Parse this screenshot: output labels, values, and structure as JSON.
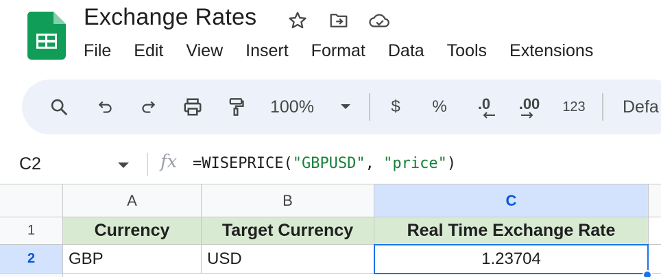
{
  "app": {
    "title": "Exchange Rates",
    "brand_color": "#0f9d58",
    "accent": "#1a73e8"
  },
  "title_icons": [
    "star-icon",
    "move-to-folder-icon",
    "cloud-saved-icon"
  ],
  "menu": [
    "File",
    "Edit",
    "View",
    "Insert",
    "Format",
    "Data",
    "Tools",
    "Extensions"
  ],
  "toolbar": {
    "zoom": "100%",
    "currency_label": "$",
    "percent_label": "%",
    "decrease_decimal_label": ".0",
    "increase_decimal_label": ".00",
    "more_formats_label": "123",
    "font_label": "Defa"
  },
  "formula_bar": {
    "cell_ref": "C2",
    "fx_label": "fx",
    "formula_fn": "=WISEPRICE(",
    "formula_arg1": "\"GBPUSD\"",
    "formula_sep": ", ",
    "formula_arg2": "\"price\"",
    "formula_end": ")"
  },
  "grid": {
    "columns": [
      "A",
      "B",
      "C"
    ],
    "rows": [
      "1",
      "2"
    ],
    "cells": [
      [
        "Currency",
        "Target Currency",
        "Real Time Exchange Rate"
      ],
      [
        "GBP",
        "USD",
        "1.23704"
      ]
    ],
    "header_fill": "#d9ead3",
    "selected_cell": "C2"
  }
}
